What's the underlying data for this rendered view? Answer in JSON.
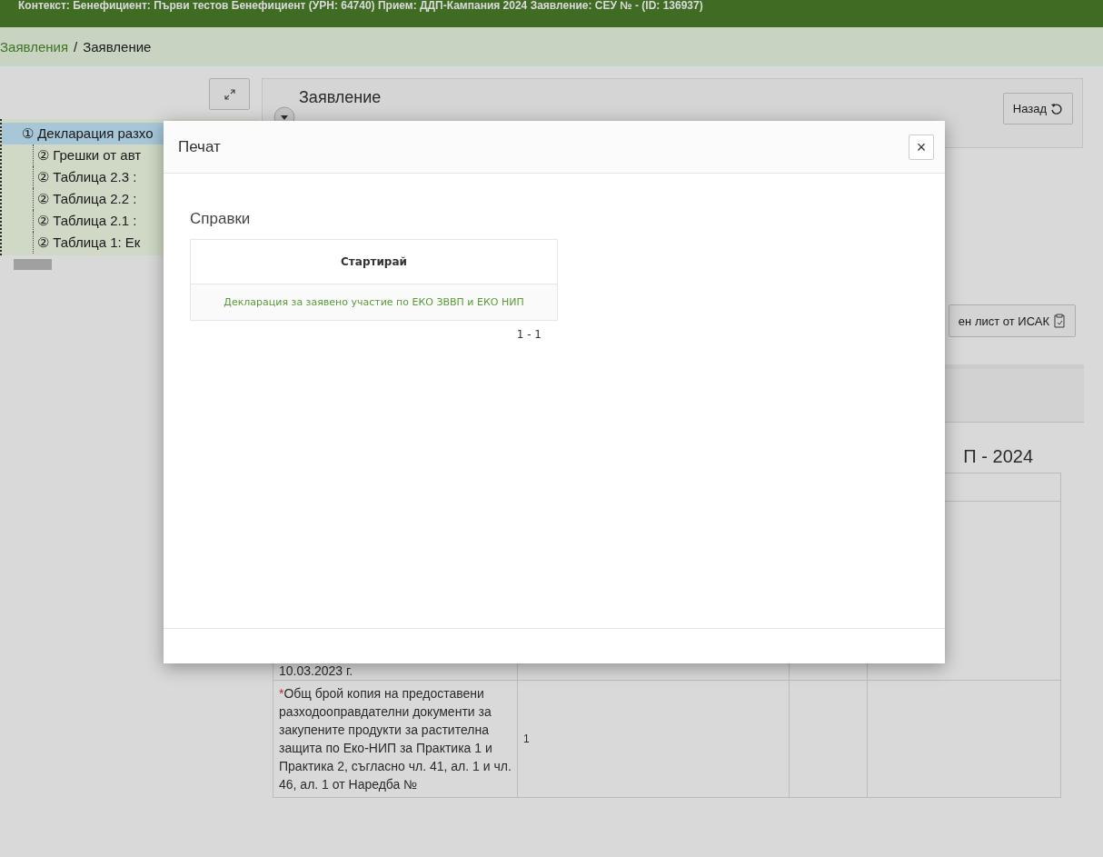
{
  "context_bar": {
    "text": "Контекст: Бенефициент: Първи тестов Бенефициент (УРН: 64740) Прием: ДДП-Кампания 2024 Заявление: СЕУ № - (ID: 136937)"
  },
  "breadcrumb": [
    {
      "label": "Заявления",
      "link": true
    },
    {
      "label": "/",
      "link": false
    },
    {
      "label": "Заявление",
      "link": false
    }
  ],
  "tree": [
    {
      "label": "① Декларация разхо",
      "selected": true,
      "children": [
        {
          "label": "② Грешки от авт",
          "selected": false
        },
        {
          "label": "② Таблица 2.3 :",
          "selected": false
        },
        {
          "label": "② Таблица 2.2 :",
          "selected": false
        },
        {
          "label": "② Таблица 2.1 :",
          "selected": false
        },
        {
          "label": "② Таблица 1: Ек",
          "selected": false
        }
      ]
    }
  ],
  "panel": {
    "title": "Заявление",
    "back_button": "Назад",
    "isak_button": "ен лист от ИСАК",
    "heading": "П - 2024"
  },
  "table_rows": [
    {
      "marker": "",
      "text": "10.03.2023 г.",
      "value": ""
    },
    {
      "marker": "*",
      "text": "Общ брой копия на предоставени разходооправдателни документи за закупените продукти за растителна защита по Еко-НИП за Практика 1 и Практика 2, съгласно чл. 41, ал. 1 и чл. 46, ал. 1 от Наредба №",
      "value": "1"
    }
  ],
  "modal": {
    "title": "Печат",
    "close": "×",
    "section": "Справки",
    "column": "Стартирай",
    "rows": [
      "Декларация за заявено участие по ЕКО ЗВВП и ЕКО НИП"
    ],
    "pagination": "1 - 1"
  }
}
